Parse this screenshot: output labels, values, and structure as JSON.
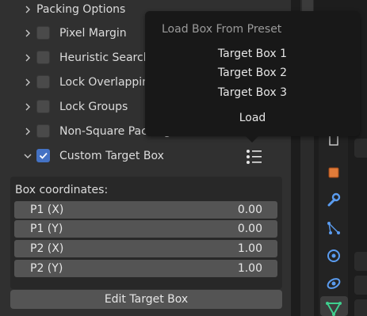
{
  "options": [
    {
      "label": "Packing Options",
      "type": "header"
    },
    {
      "label": "Pixel Margin",
      "checked": false
    },
    {
      "label": "Heuristic Search",
      "checked": false
    },
    {
      "label": "Lock Overlapping",
      "checked": false
    },
    {
      "label": "Lock Groups",
      "checked": false
    },
    {
      "label": "Non-Square Packing",
      "checked": false
    },
    {
      "label": "Custom Target Box",
      "checked": true
    }
  ],
  "target_box": {
    "title": "Box coordinates:",
    "fields": [
      {
        "label": "P1 (X)",
        "value": "0.00"
      },
      {
        "label": "P1 (Y)",
        "value": "0.00"
      },
      {
        "label": "P2 (X)",
        "value": "1.00"
      },
      {
        "label": "P2 (Y)",
        "value": "1.00"
      }
    ],
    "edit_button": "Edit Target Box"
  },
  "preset_menu": {
    "title": "Load Box From Preset",
    "items": [
      "Target Box 1",
      "Target Box 2",
      "Target Box 3"
    ],
    "load": "Load"
  },
  "colors": {
    "accent": "#4472c4",
    "panel_bg": "#303030",
    "field_bg": "#545454",
    "popup_bg": "#181818"
  },
  "icons": [
    "chevron-right-icon",
    "chevron-down-icon",
    "checkmark-icon",
    "preset-list-icon",
    "wrench-icon",
    "particles-icon",
    "physics-icon",
    "constraint-icon",
    "object-data-icon",
    "modifier-icon"
  ]
}
